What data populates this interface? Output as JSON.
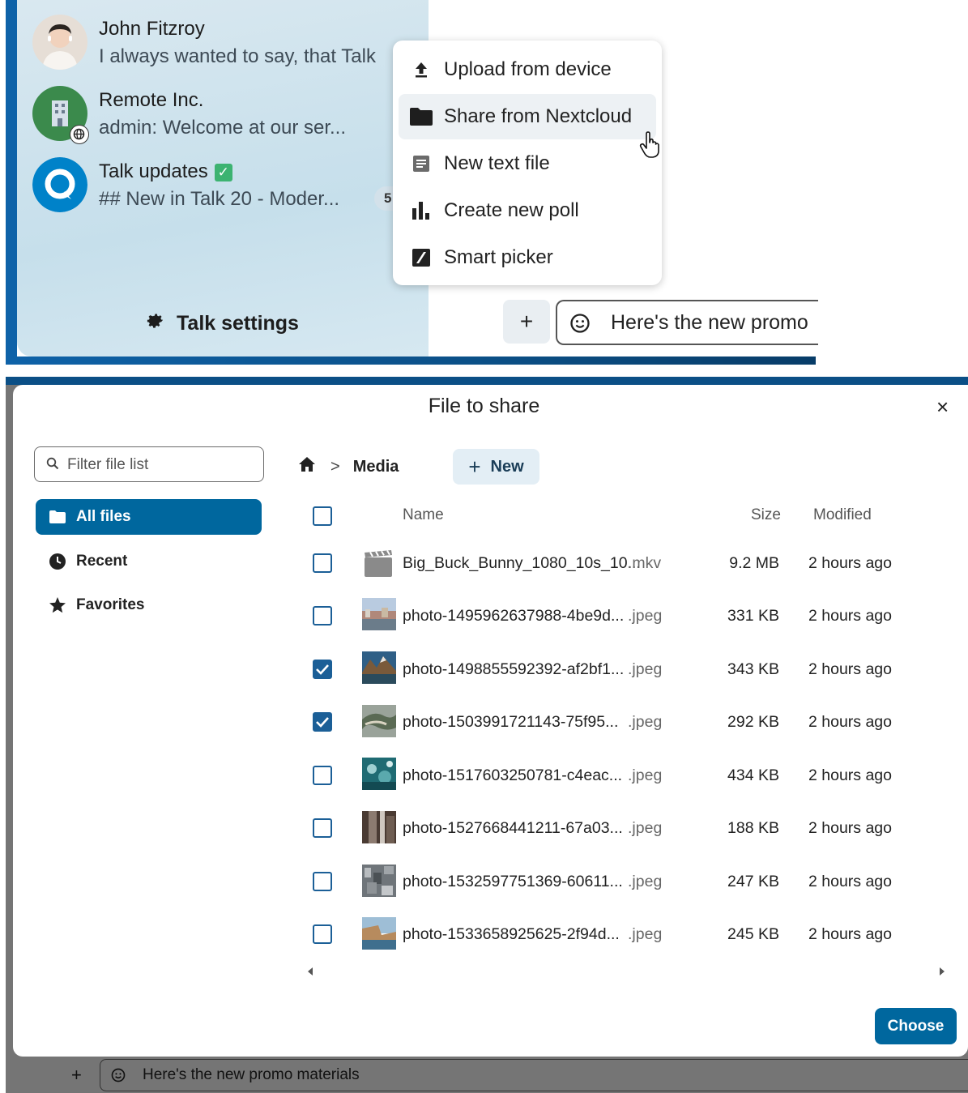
{
  "conversations": [
    {
      "name": "John Fitzroy",
      "preview": "I always wanted to say, that Talk"
    },
    {
      "name": "Remote Inc.",
      "preview": "admin: Welcome at our ser..."
    },
    {
      "name": "Talk updates",
      "preview": "## New in Talk 20 - Moder...",
      "unread": "5",
      "emoji": "✓"
    }
  ],
  "sidebar": {
    "settings_label": "Talk settings"
  },
  "attach_menu": {
    "items": [
      {
        "label": "Upload from device",
        "icon": "upload-icon"
      },
      {
        "label": "Share from Nextcloud",
        "icon": "folder-icon"
      },
      {
        "label": "New text file",
        "icon": "text-file-icon"
      },
      {
        "label": "Create new poll",
        "icon": "poll-icon"
      },
      {
        "label": "Smart picker",
        "icon": "smart-picker-icon"
      }
    ]
  },
  "composer": {
    "plus_label": "+",
    "message_top": "Here's the new promo",
    "message_bottom": "Here's the new promo materials"
  },
  "file_picker": {
    "title": "File to share",
    "close_label": "×",
    "filter_placeholder": "Filter file list",
    "nav": [
      {
        "label": "All files",
        "icon": "folder-icon"
      },
      {
        "label": "Recent",
        "icon": "clock-icon"
      },
      {
        "label": "Favorites",
        "icon": "star-icon"
      }
    ],
    "breadcrumb": {
      "current": "Media",
      "separator": ">"
    },
    "new_button": {
      "icon": "+",
      "label": "New"
    },
    "columns": {
      "name": "Name",
      "size": "Size",
      "modified": "Modified"
    },
    "files": [
      {
        "name": "Big_Buck_Bunny_1080_10s_10...",
        "ext": ".mkv",
        "size": "9.2 MB",
        "modified": "2 hours ago",
        "checked": false,
        "type": "video"
      },
      {
        "name": "photo-1495962637988-4be9d...",
        "ext": ".jpeg",
        "size": "331 KB",
        "modified": "2 hours ago",
        "checked": false,
        "type": "image"
      },
      {
        "name": "photo-1498855592392-af2bf1...",
        "ext": ".jpeg",
        "size": "343 KB",
        "modified": "2 hours ago",
        "checked": true,
        "type": "image"
      },
      {
        "name": "photo-1503991721143-75f95...",
        "ext": ".jpeg",
        "size": "292 KB",
        "modified": "2 hours ago",
        "checked": true,
        "type": "image"
      },
      {
        "name": "photo-1517603250781-c4eac...",
        "ext": ".jpeg",
        "size": "434 KB",
        "modified": "2 hours ago",
        "checked": false,
        "type": "image"
      },
      {
        "name": "photo-1527668441211-67a03...",
        "ext": ".jpeg",
        "size": "188 KB",
        "modified": "2 hours ago",
        "checked": false,
        "type": "image"
      },
      {
        "name": "photo-1532597751369-60611...",
        "ext": ".jpeg",
        "size": "247 KB",
        "modified": "2 hours ago",
        "checked": false,
        "type": "image"
      },
      {
        "name": "photo-1533658925625-2f94d...",
        "ext": ".jpeg",
        "size": "245 KB",
        "modified": "2 hours ago",
        "checked": false,
        "type": "image"
      }
    ],
    "choose_label": "Choose"
  },
  "colors": {
    "primary": "#00679e",
    "accent_dark": "#0e62a8",
    "checkbox": "#1b5f97"
  }
}
